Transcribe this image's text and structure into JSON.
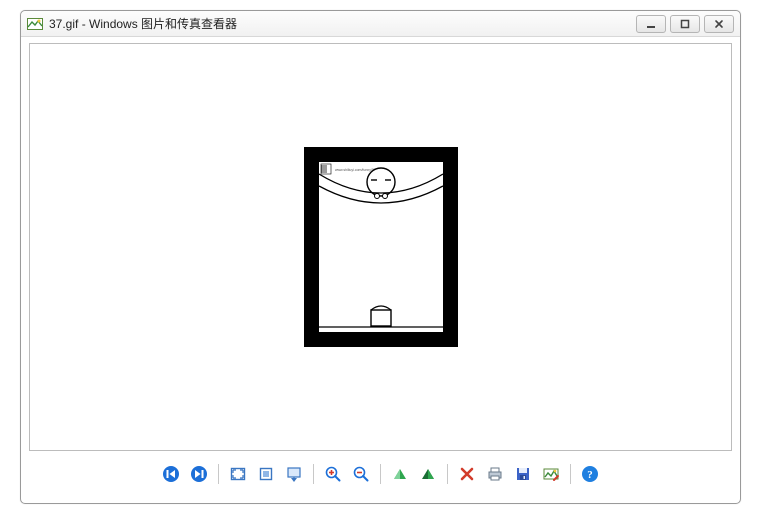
{
  "window": {
    "filename": "37.gif",
    "app_name": "Windows 图片和传真查看器",
    "title_sep": " - "
  },
  "controls": {
    "minimize": "minimize",
    "maximize": "maximize",
    "close": "close"
  },
  "toolbar": {
    "prev": "previous-image",
    "next": "next-image",
    "fit": "best-fit",
    "actual": "actual-size",
    "slideshow": "start-slideshow",
    "zoom_in": "zoom-in",
    "zoom_out": "zoom-out",
    "rotate_ccw": "rotate-counterclockwise",
    "rotate_cw": "rotate-clockwise",
    "delete": "delete",
    "print": "print",
    "save": "copy-to",
    "edit": "open-for-edit",
    "help": "help"
  },
  "colors": {
    "accent_blue": "#1c6fd8",
    "accent_green": "#2fa64f",
    "delete_red": "#d23b2a",
    "save_blue": "#3c63c7",
    "help_blue": "#1f7fe0"
  }
}
